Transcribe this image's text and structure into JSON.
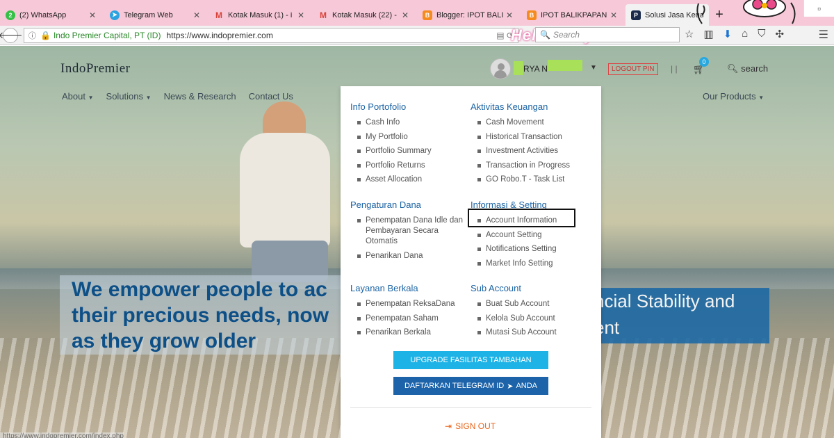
{
  "browser": {
    "tabs": [
      {
        "title": "(2) WhatsApp",
        "badge": "2",
        "favicon": "whatsapp-icon",
        "color": "#35c046"
      },
      {
        "title": "Telegram Web",
        "favicon": "telegram-icon",
        "color": "#2aa3e0"
      },
      {
        "title": "Kotak Masuk (1) - i",
        "favicon": "gmail-icon",
        "color": "#d9443a"
      },
      {
        "title": "Kotak Masuk (22) -",
        "favicon": "gmail-icon",
        "color": "#d9443a"
      },
      {
        "title": "Blogger: IPOT BALI",
        "favicon": "blogger-icon",
        "color": "#f58a1f"
      },
      {
        "title": "IPOT BALIKPAPAN",
        "favicon": "blogger-icon",
        "color": "#f58a1f"
      },
      {
        "title": "Solusi Jasa Keuang",
        "favicon": "indopremier-icon",
        "color": "#1b2a4a"
      }
    ],
    "new_tab_label": "+",
    "site_identity": "Indo Premier Capital, PT (ID)",
    "url": "https://www.indopremier.com",
    "search_placeholder": "Search",
    "theme_text": "Hello Kitty",
    "status_url": "https://www.indopremier.com/index.php"
  },
  "header": {
    "logo": "IndoPremier",
    "username": "RYA N",
    "logout_label": "LOGOUT PIN",
    "separator": "| |",
    "cart_count": "0",
    "search_label": "search"
  },
  "nav": {
    "items": [
      "About",
      "Solutions",
      "News & Research",
      "Contact Us"
    ],
    "our_products": "Our Products"
  },
  "hero": {
    "left_text": "We empower people to ac\ntheir precious needs, now\nas they grow older",
    "right_text": "ncial Stability and\nent"
  },
  "menu": {
    "sections": [
      {
        "title": "Info Portofolio",
        "items": [
          "Cash Info",
          "My Portfolio",
          "Portfolio Summary",
          "Portfolio Returns",
          "Asset Allocation"
        ]
      },
      {
        "title": "Aktivitas Keuangan",
        "items": [
          "Cash Movement",
          "Historical Transaction",
          "Investment Activities",
          "Transaction in Progress",
          "GO Robo.T - Task List"
        ]
      },
      {
        "title": "Pengaturan Dana",
        "items": [
          "Penempatan Dana Idle dan Pembayaran Secara Otomatis",
          "Penarikan Dana"
        ]
      },
      {
        "title": "Informasi & Setting",
        "items": [
          "Account Information",
          "Account Setting",
          "Notifications Setting",
          "Market Info Setting"
        ]
      },
      {
        "title": "Layanan Berkala",
        "items": [
          "Penempatan ReksaDana",
          "Penempatan Saham",
          "Penarikan Berkala"
        ]
      },
      {
        "title": "Sub Account",
        "items": [
          "Buat Sub Account",
          "Kelola Sub Account",
          "Mutasi Sub Account"
        ]
      }
    ],
    "upgrade_label": "UPGRADE FASILITAS TAMBAHAN",
    "telegram_label": "DAFTARKAN TELEGRAM ID",
    "telegram_suffix": "ANDA",
    "signout_label": "SIGN OUT"
  }
}
